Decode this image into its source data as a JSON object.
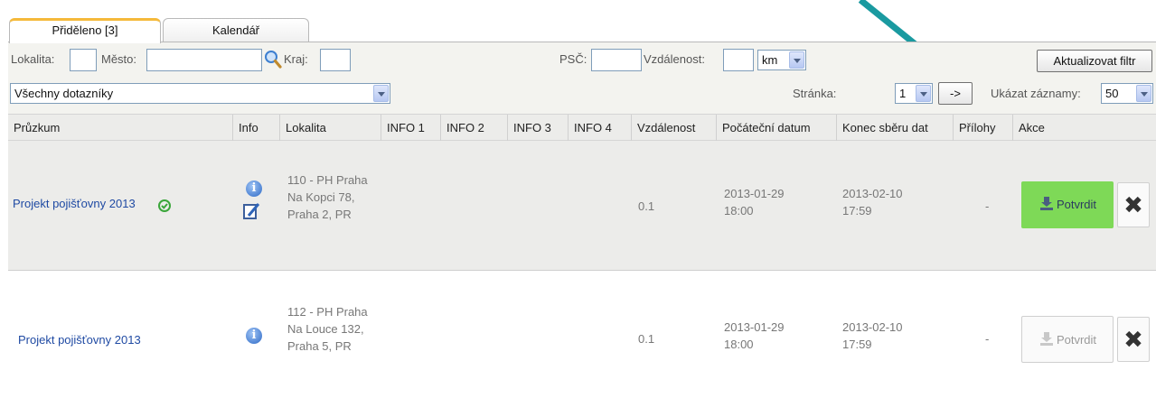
{
  "tabs": [
    {
      "label": "Přiděleno [3]",
      "active": true
    },
    {
      "label": "Kalendář",
      "active": false
    }
  ],
  "filters": {
    "lokalita_label": "Lokalita:",
    "mesto_label": "Město:",
    "kraj_label": "Kraj:",
    "psc_label": "PSČ:",
    "vzdalenost_label": "Vzdálenost:",
    "unit_selected": "km",
    "update_button": "Aktualizovat filtr",
    "questionnaire_selected": "Všechny dotazníky",
    "page_label": "Stránka:",
    "page_selected": "1",
    "go_button": "->",
    "show_records_label": "Ukázat záznamy:",
    "records_selected": "50"
  },
  "columns": [
    "Průzkum",
    "Info",
    "Lokalita",
    "INFO 1",
    "INFO 2",
    "INFO 3",
    "INFO 4",
    "Vzdálenost",
    "Počáteční datum",
    "Konec sběru dat",
    "Přílohy",
    "Akce"
  ],
  "rows": [
    {
      "survey": "Projekt pojišťovny 2013",
      "lokalita": [
        "110 - PH Praha",
        "Na Kopci 78,",
        "Praha 2, PR"
      ],
      "distance": "0.1",
      "start": [
        "2013-01-29",
        "18:00"
      ],
      "end": [
        "2013-02-10",
        "17:59"
      ],
      "attachments": "-",
      "confirm_label": "Potvrdit"
    },
    {
      "survey": "Projekt pojišťovny 2013",
      "lokalita": [
        "112 - PH Praha",
        "Na Louce 132,",
        "Praha 5, PR"
      ],
      "distance": "0.1",
      "start": [
        "2013-01-29",
        "18:00"
      ],
      "end": [
        "2013-02-10",
        "17:59"
      ],
      "attachments": "-",
      "confirm_label": "Potvrdit"
    }
  ],
  "colors": {
    "tab_accent": "#f5b93a",
    "confirm_active": "#7ed957",
    "link": "#1f4aa3",
    "annotation_arrow": "#1a9aa0",
    "check_green": "#3aa63a"
  },
  "icons": {
    "search": "search-icon",
    "info": "info-icon",
    "edit": "edit-icon",
    "verified": "check-circle-icon",
    "download": "download-icon",
    "delete": "close-icon",
    "annotation": "arrow-annotation"
  }
}
